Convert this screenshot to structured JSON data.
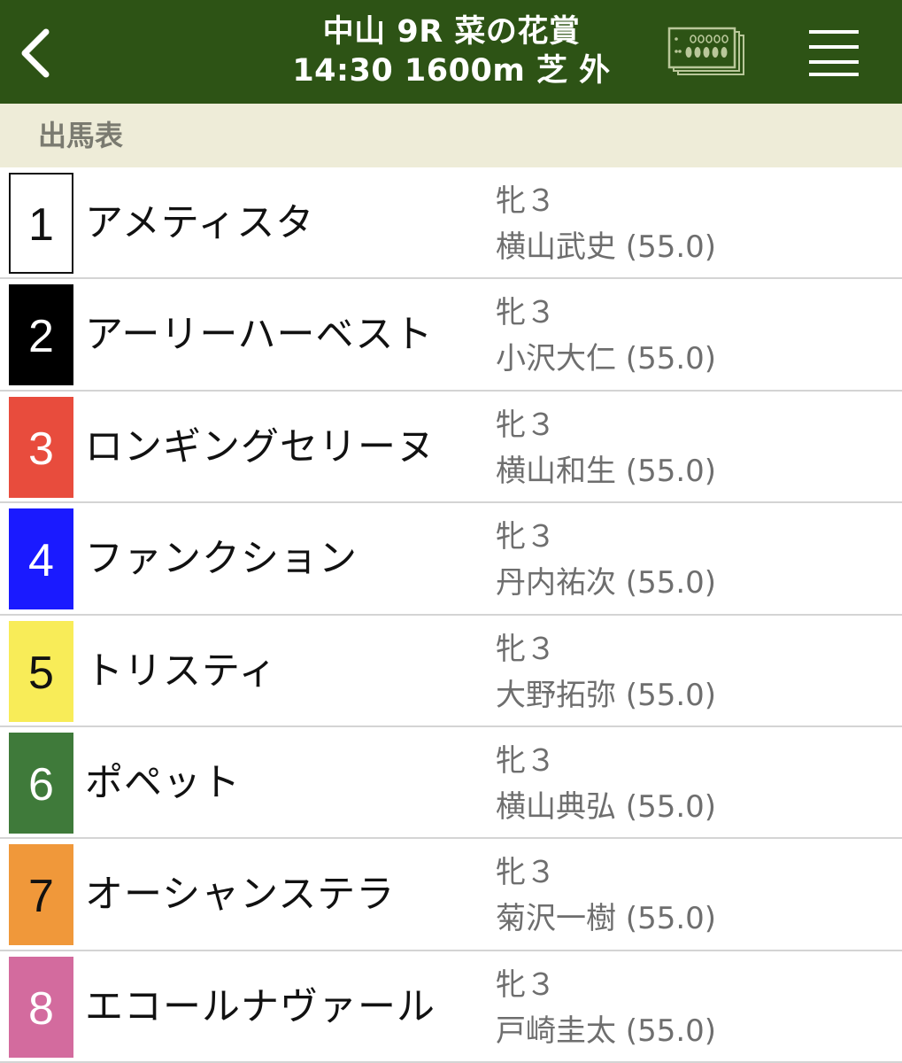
{
  "header": {
    "back_icon": "chevron-left-icon",
    "title_line1": "中山 9R 菜の花賞",
    "title_line2": "14:30 1600m 芝 外",
    "ticket_icon": "betting-ticket-icon",
    "menu_icon": "hamburger-menu-icon",
    "bg_color": "#2d5315"
  },
  "section": {
    "title": "出馬表",
    "bg_color": "#eeecd8"
  },
  "entries": [
    {
      "number": "1",
      "name": "アメティスタ",
      "sexage": "牝３",
      "jockey": "横山武史 (55.0)",
      "box_color": "#ffffff",
      "text_color": "#111111",
      "border": "#111111"
    },
    {
      "number": "2",
      "name": "アーリーハーベスト",
      "sexage": "牝３",
      "jockey": "小沢大仁 (55.0)",
      "box_color": "#000000",
      "text_color": "#ffffff",
      "border": "#000000"
    },
    {
      "number": "3",
      "name": "ロンギングセリーヌ",
      "sexage": "牝３",
      "jockey": "横山和生 (55.0)",
      "box_color": "#e84c3d",
      "text_color": "#ffffff",
      "border": "#e84c3d"
    },
    {
      "number": "4",
      "name": "ファンクション",
      "sexage": "牝３",
      "jockey": "丹内祐次 (55.0)",
      "box_color": "#1a1aff",
      "text_color": "#ffffff",
      "border": "#1a1aff"
    },
    {
      "number": "5",
      "name": "トリスティ",
      "sexage": "牝３",
      "jockey": "大野拓弥 (55.0)",
      "box_color": "#f8ec58",
      "text_color": "#111111",
      "border": "#f8ec58"
    },
    {
      "number": "6",
      "name": "ポペット",
      "sexage": "牝３",
      "jockey": "横山典弘 (55.0)",
      "box_color": "#3f7a3a",
      "text_color": "#ffffff",
      "border": "#3f7a3a"
    },
    {
      "number": "7",
      "name": "オーシャンステラ",
      "sexage": "牝３",
      "jockey": "菊沢一樹 (55.0)",
      "box_color": "#f0983a",
      "text_color": "#111111",
      "border": "#f0983a"
    },
    {
      "number": "8",
      "name": "エコールナヴァール",
      "sexage": "牝３",
      "jockey": "戸崎圭太 (55.0)",
      "box_color": "#d36b9e",
      "text_color": "#ffffff",
      "border": "#d36b9e"
    }
  ]
}
